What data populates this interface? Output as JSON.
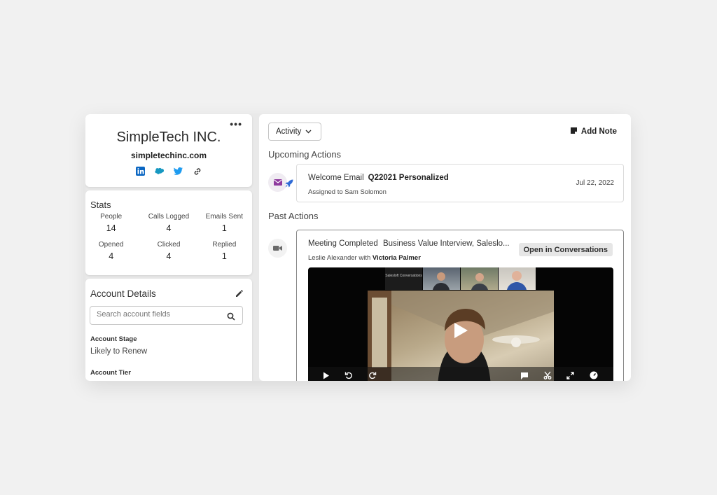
{
  "company": {
    "name": "SimpleTech INC.",
    "domain": "simpletechinc.com",
    "more_label": "•••",
    "social_icons": [
      "linkedin-icon",
      "salesforce-icon",
      "twitter-icon",
      "link-icon"
    ]
  },
  "stats": {
    "title": "Stats",
    "items": [
      {
        "label": "People",
        "value": "14"
      },
      {
        "label": "Calls Logged",
        "value": "4"
      },
      {
        "label": "Emails Sent",
        "value": "1"
      },
      {
        "label": "Opened",
        "value": "4"
      },
      {
        "label": "Clicked",
        "value": "4"
      },
      {
        "label": "Replied",
        "value": "1"
      }
    ]
  },
  "account_details": {
    "title": "Account Details",
    "search_placeholder": "Search account fields",
    "fields": [
      {
        "label": "Account Stage",
        "value": "Likely to Renew"
      },
      {
        "label": "Account Tier",
        "value": ""
      }
    ]
  },
  "activity": {
    "filter_label": "Activity",
    "add_note_label": "Add Note",
    "upcoming_heading": "Upcoming Actions",
    "past_heading": "Past Actions",
    "upcoming": {
      "type": "Welcome Email",
      "title": "Q22021 Personalized",
      "assigned": "Assigned to Sam Solomon",
      "date": "Jul 22, 2022"
    },
    "past": {
      "type": "Meeting Completed",
      "title": "Business Value Interview, Saleslo...",
      "participants_prefix": "Leslie Alexander with",
      "participant": "Victoria Palmer",
      "open_label": "Open in Conversations",
      "video_logo_text": "Salesloft Conversations"
    }
  },
  "colors": {
    "accent_purple": "#8e3a9e",
    "linkedin": "#0a66c2",
    "salesforce": "#1798c1",
    "twitter": "#1d9bf0",
    "rocket": "#2f6bd6"
  }
}
